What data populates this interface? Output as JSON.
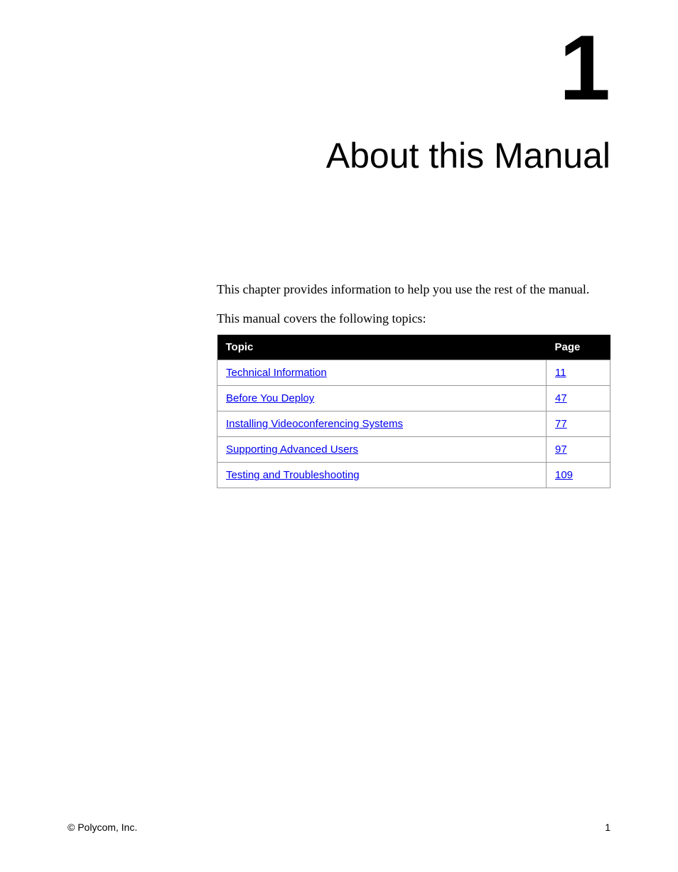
{
  "chapter": {
    "number": "1",
    "title": "About this Manual"
  },
  "intro": "This chapter provides information to help you use the rest of the manual.",
  "subtitle": "This manual covers the following topics:",
  "table": {
    "headers": {
      "topic": "Topic",
      "page": "Page"
    },
    "rows": [
      {
        "topic": "Technical Information",
        "page": "11"
      },
      {
        "topic": "Before You Deploy",
        "page": "47"
      },
      {
        "topic": "Installing Videoconferencing Systems",
        "page": "77"
      },
      {
        "topic": "Supporting Advanced Users",
        "page": "97"
      },
      {
        "topic": "Testing and Troubleshooting",
        "page": "109"
      }
    ]
  },
  "footer": {
    "copyright": "© Polycom, Inc.",
    "pageNumber": "1"
  }
}
